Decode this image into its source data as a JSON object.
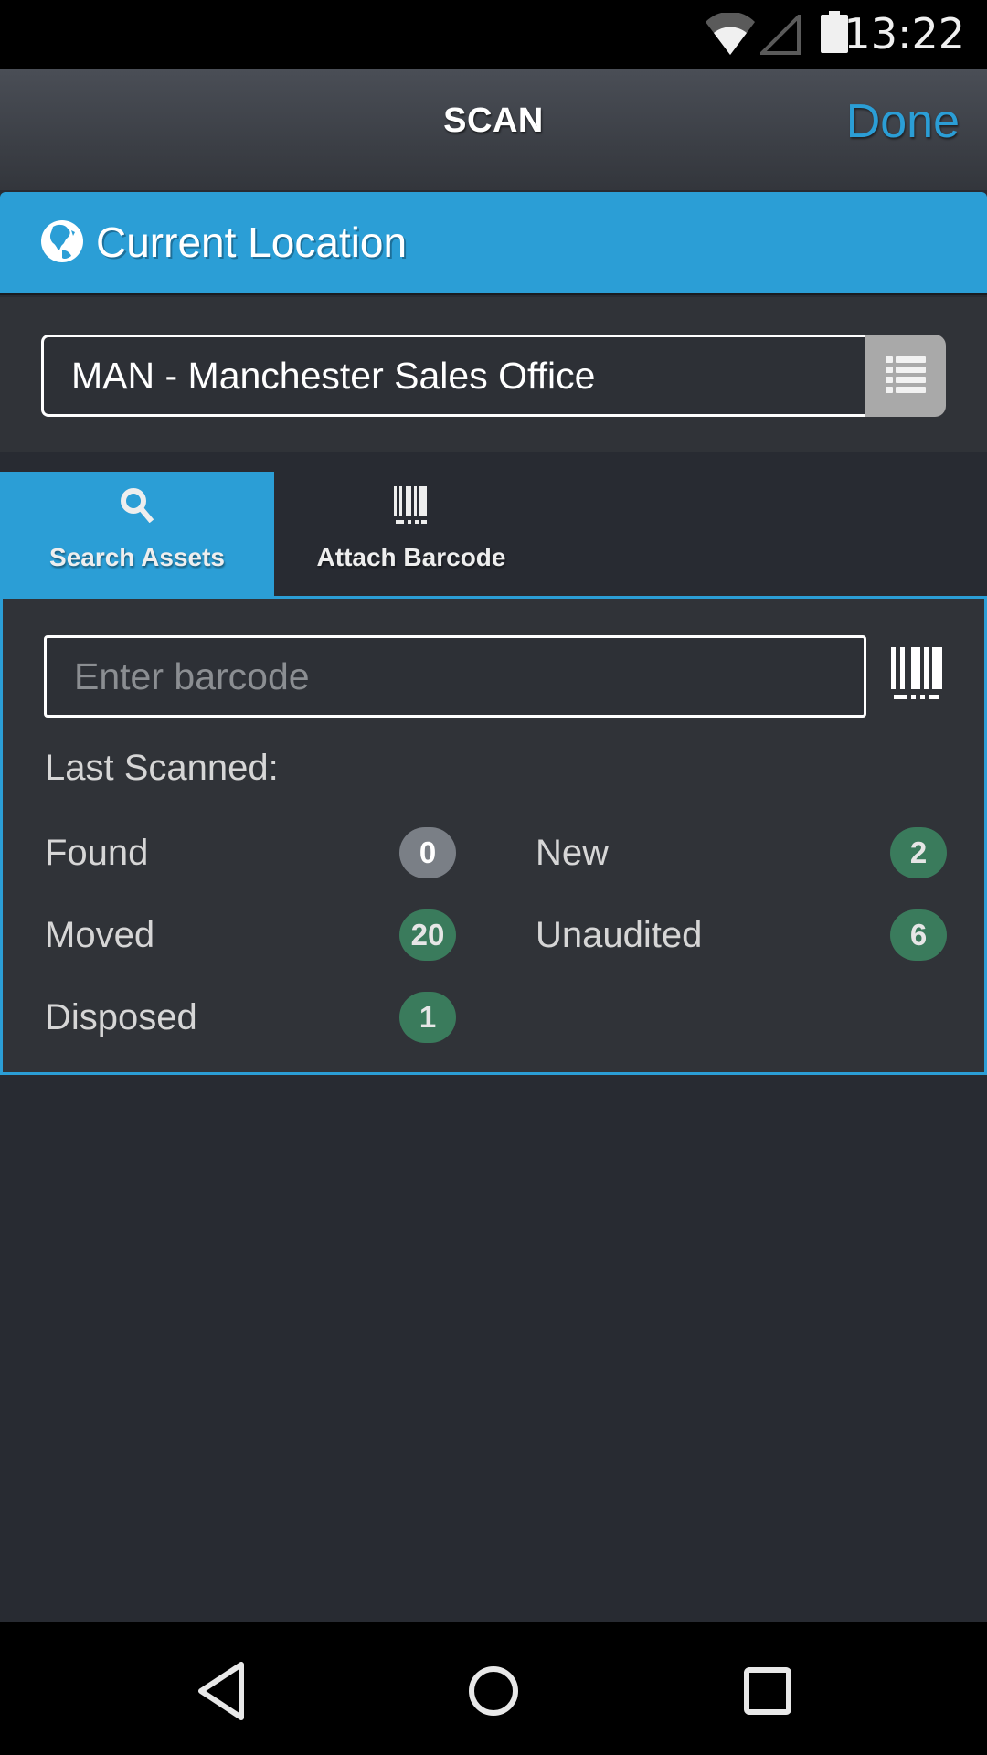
{
  "status_bar": {
    "time": "13:22",
    "icons": [
      "wifi-icon",
      "cell-signal-icon",
      "battery-icon"
    ]
  },
  "header": {
    "title": "SCAN",
    "done_label": "Done"
  },
  "location": {
    "title": "Current Location",
    "icon": "globe-icon",
    "selected_value": "MAN - Manchester Sales Office",
    "list_button_icon": "list-icon"
  },
  "tabs": [
    {
      "label": "Search Assets",
      "icon": "search-icon",
      "active": true
    },
    {
      "label": "Attach Barcode",
      "icon": "barcode-icon",
      "active": false
    }
  ],
  "scan_panel": {
    "barcode_input": {
      "value": "",
      "placeholder": "Enter barcode"
    },
    "scan_button_icon": "barcode-icon",
    "last_scanned_label": "Last Scanned:",
    "stats": [
      {
        "label": "Found",
        "count": "0",
        "status": "gray"
      },
      {
        "label": "New",
        "count": "2",
        "status": "green"
      },
      {
        "label": "Moved",
        "count": "20",
        "status": "green"
      },
      {
        "label": "Unaudited",
        "count": "6",
        "status": "green"
      },
      {
        "label": "Disposed",
        "count": "1",
        "status": "green"
      }
    ]
  },
  "colors": {
    "accent": "#2b9ed6",
    "badge_green": "#3a7b5c",
    "badge_gray": "#7a7f86",
    "background": "#282b32"
  },
  "nav_bar": {
    "buttons": [
      "back-icon",
      "home-icon",
      "recents-icon"
    ]
  }
}
